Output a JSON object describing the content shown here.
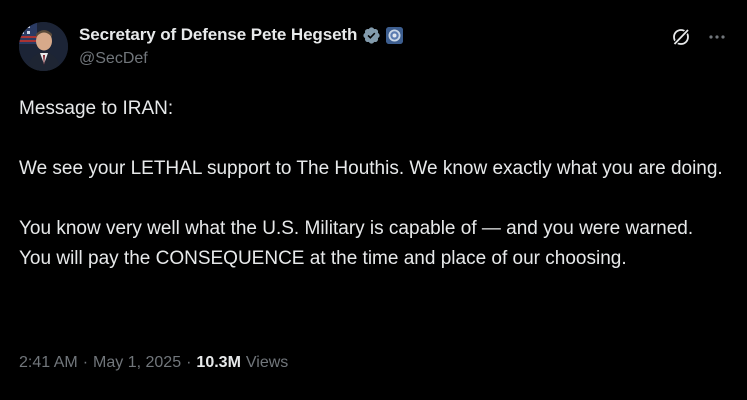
{
  "author": {
    "display_name": "Secretary of Defense Pete Hegseth",
    "handle": "@SecDef",
    "verified_color": "#829aab"
  },
  "header_actions": {
    "grok_icon": "grok-icon",
    "more_icon": "more-icon"
  },
  "post": {
    "text": "Message to IRAN:\n\nWe see your LETHAL support to The Houthis. We know exactly what you are doing.\n\nYou know very well what the U.S. Military is capable of — and you were warned. You will pay the CONSEQUENCE at the time and place of our choosing."
  },
  "meta": {
    "time": "2:41 AM",
    "separator": "·",
    "date": "May 1, 2025",
    "views_count": "10.3M",
    "views_label": "Views"
  },
  "colors": {
    "background": "#000000",
    "text_primary": "#e7e9ea",
    "text_secondary": "#71767b"
  }
}
